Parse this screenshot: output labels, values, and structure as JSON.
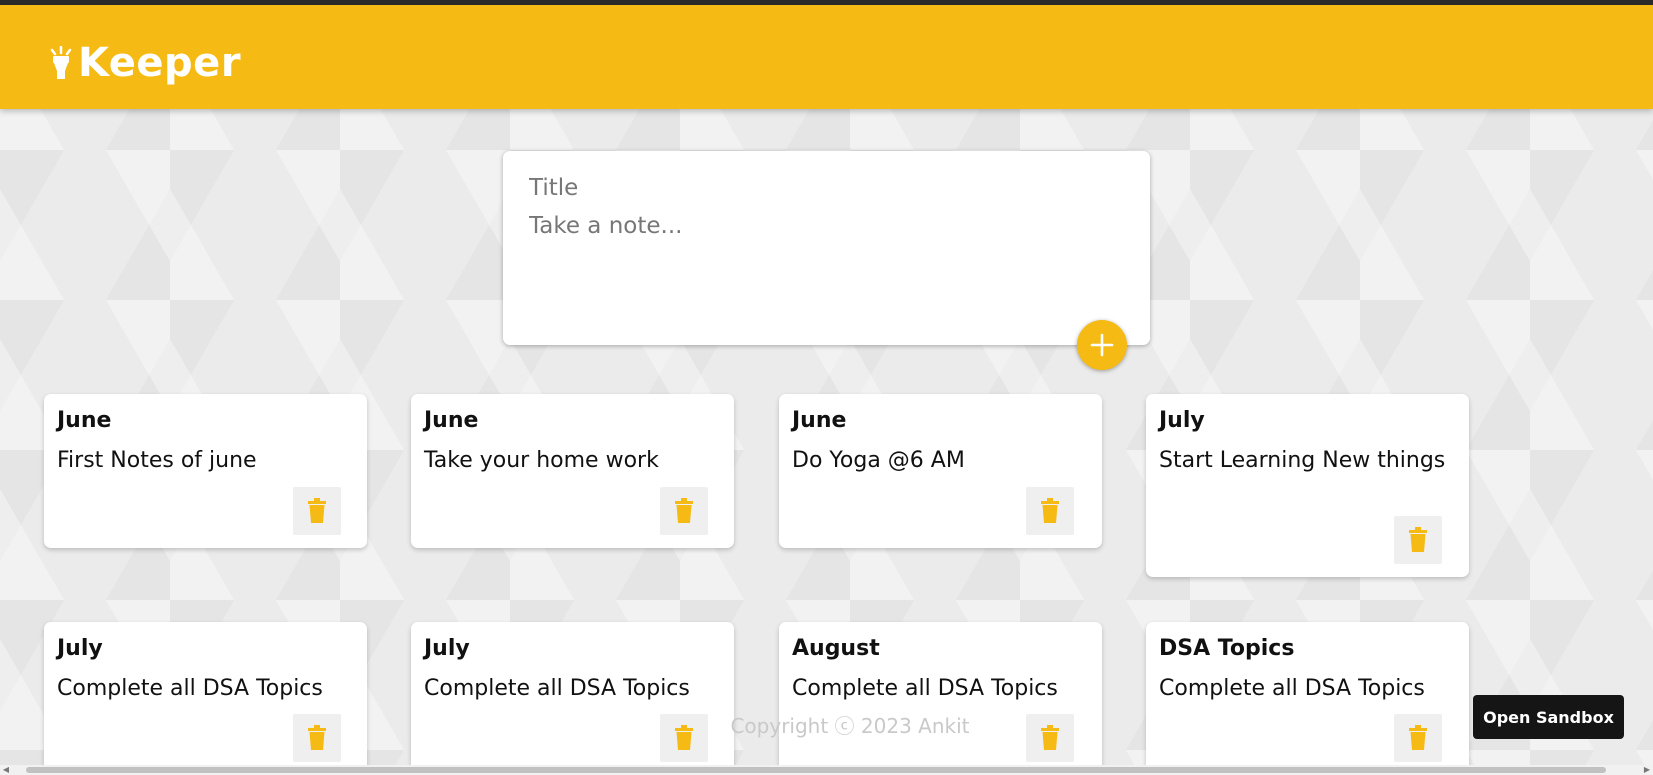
{
  "header": {
    "app_name": "Keeper",
    "icon": "flashlight-icon",
    "brand_color": "#f5ba13"
  },
  "create_area": {
    "title_placeholder": "Title",
    "content_placeholder": "Take a note...",
    "add_icon": "plus-icon"
  },
  "notes": [
    {
      "title": "June",
      "content": "First Notes of june"
    },
    {
      "title": "June",
      "content": "Take your home work"
    },
    {
      "title": "June",
      "content": "Do Yoga @6 AM"
    },
    {
      "title": "July",
      "content": "Start Learning New things"
    },
    {
      "title": "July",
      "content": "Complete all DSA Topics"
    },
    {
      "title": "July",
      "content": "Complete all DSA Topics"
    },
    {
      "title": "August",
      "content": "Complete all DSA Topics"
    },
    {
      "title": "DSA Topics",
      "content": "Complete all DSA Topics"
    }
  ],
  "note_delete_icon": "trash-icon",
  "footer": {
    "copyright": "Copyright ⓒ 2023 Ankit"
  },
  "sandbox": {
    "label": "Open Sandbox"
  }
}
